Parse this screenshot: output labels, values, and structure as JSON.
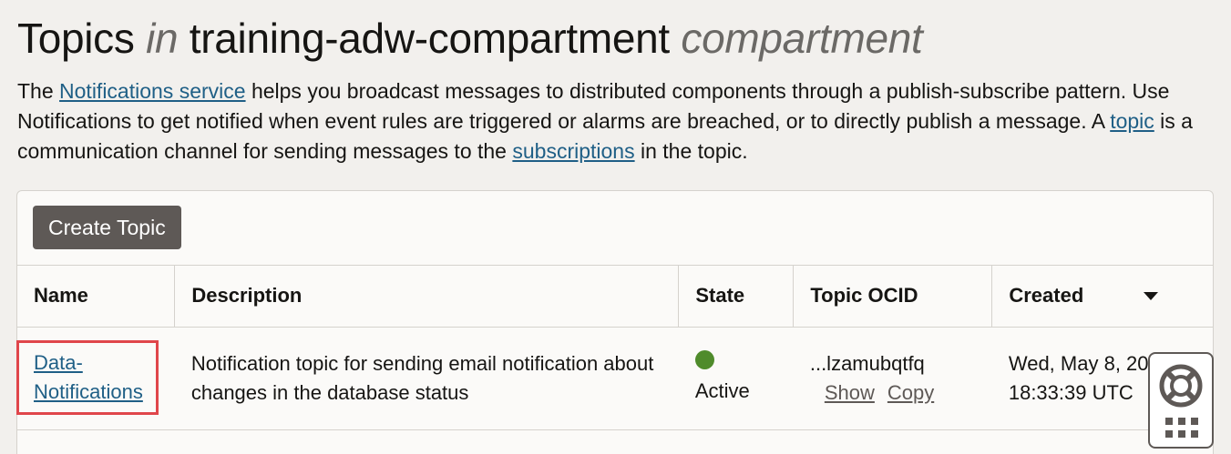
{
  "header": {
    "title_prefix": "Topics",
    "title_in": "in",
    "title_compartment": "training-adw-compartment",
    "title_suffix": "compartment"
  },
  "intro": {
    "t1": "The ",
    "link_service": "Notifications service",
    "t2": " helps you broadcast messages to distributed components through a publish-subscribe pattern. Use Notifications to get notified when event rules are triggered or alarms are breached, or to directly publish a message. A ",
    "link_topic": "topic",
    "t3": " is a communication channel for sending messages to the ",
    "link_subscriptions": "subscriptions",
    "t4": " in the topic."
  },
  "toolbar": {
    "create_label": "Create Topic"
  },
  "table": {
    "columns": [
      "Name",
      "Description",
      "State",
      "Topic OCID",
      "Created"
    ],
    "rows": [
      {
        "name": "Data-Notifications",
        "name_line1": "Data-",
        "name_line2": "Notifications",
        "description": "Notification topic for sending email notification about changes in the database status",
        "state": "Active",
        "ocid": "...lzamubqtfq",
        "show": "Show",
        "copy": "Copy",
        "created": "Wed, May 8, 2024, 18:33:39 UTC"
      }
    ]
  },
  "colors": {
    "link": "#1f5f86",
    "state_active": "#4f8b2b",
    "highlight_border": "#e0464b",
    "button_bg": "#5e5956"
  },
  "icons": {
    "sort": "chevron-down-icon",
    "help": "help-ring-icon",
    "apps": "grid-icon"
  }
}
